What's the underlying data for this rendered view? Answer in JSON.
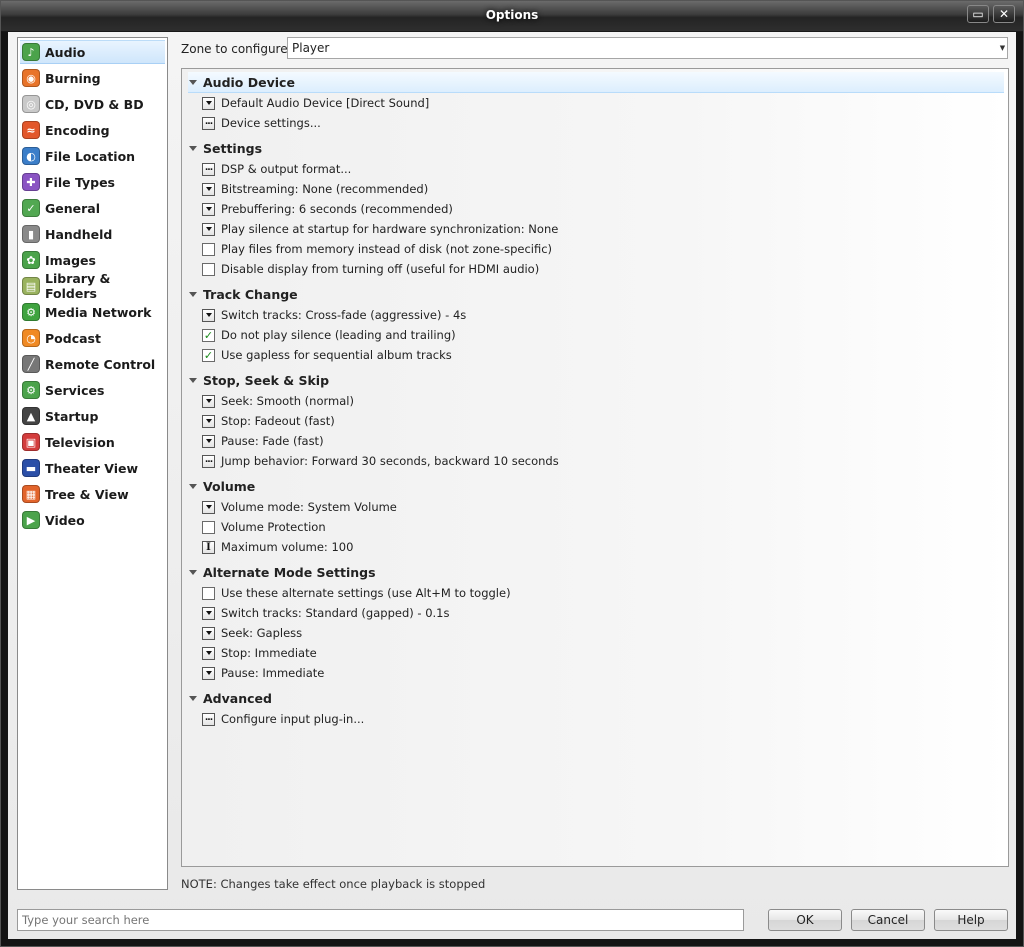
{
  "window": {
    "title": "Options",
    "controls": {
      "restore": "▭",
      "close": "✕"
    }
  },
  "sidebar": {
    "items": [
      {
        "label": "Audio",
        "icon": "audio-icon",
        "color": "#4ba34b",
        "glyph": "♪"
      },
      {
        "label": "Burning",
        "icon": "burning-icon",
        "color": "#e8742a",
        "glyph": "◉"
      },
      {
        "label": "CD, DVD & BD",
        "icon": "disc-icon",
        "color": "#c9c9c9",
        "glyph": "◎"
      },
      {
        "label": "Encoding",
        "icon": "encoding-icon",
        "color": "#e2572b",
        "glyph": "≈"
      },
      {
        "label": "File Location",
        "icon": "globe-icon",
        "color": "#3b7ec9",
        "glyph": "◐"
      },
      {
        "label": "File Types",
        "icon": "file-types-icon",
        "color": "#8a54c3",
        "glyph": "✚"
      },
      {
        "label": "General",
        "icon": "general-icon",
        "color": "#52a852",
        "glyph": "✓"
      },
      {
        "label": "Handheld",
        "icon": "handheld-icon",
        "color": "#8a8a8a",
        "glyph": "▮"
      },
      {
        "label": "Images",
        "icon": "images-icon",
        "color": "#4ba34b",
        "glyph": "✿"
      },
      {
        "label": "Library & Folders",
        "icon": "library-icon",
        "color": "#9ab35f",
        "glyph": "▤"
      },
      {
        "label": "Media Network",
        "icon": "media-network-icon",
        "color": "#3fa33f",
        "glyph": "⚙"
      },
      {
        "label": "Podcast",
        "icon": "podcast-icon",
        "color": "#f08a24",
        "glyph": "◔"
      },
      {
        "label": "Remote Control",
        "icon": "remote-control-icon",
        "color": "#777777",
        "glyph": "╱"
      },
      {
        "label": "Services",
        "icon": "services-icon",
        "color": "#4ba34b",
        "glyph": "⚙"
      },
      {
        "label": "Startup",
        "icon": "startup-icon",
        "color": "#444444",
        "glyph": "▲"
      },
      {
        "label": "Television",
        "icon": "television-icon",
        "color": "#d33c3c",
        "glyph": "▣"
      },
      {
        "label": "Theater View",
        "icon": "theater-view-icon",
        "color": "#2b4fa8",
        "glyph": "▬"
      },
      {
        "label": "Tree & View",
        "icon": "tree-view-icon",
        "color": "#e2642b",
        "glyph": "▦"
      },
      {
        "label": "Video",
        "icon": "video-icon",
        "color": "#4ba34b",
        "glyph": "▶"
      }
    ]
  },
  "zone": {
    "label": "Zone to configure:",
    "value": "Player"
  },
  "groups": [
    {
      "title": "Audio Device",
      "items": [
        {
          "type": "dropdown",
          "label": "Default Audio Device [Direct Sound]"
        },
        {
          "type": "dots",
          "label": "Device settings..."
        }
      ]
    },
    {
      "title": "Settings",
      "items": [
        {
          "type": "dots",
          "label": "DSP & output format..."
        },
        {
          "type": "dropdown",
          "label": "Bitstreaming: None (recommended)"
        },
        {
          "type": "dropdown",
          "label": "Prebuffering: 6 seconds (recommended)"
        },
        {
          "type": "dropdown",
          "label": "Play silence at startup for hardware synchronization: None"
        },
        {
          "type": "checkbox",
          "checked": false,
          "label": "Play files from memory instead of disk (not zone-specific)"
        },
        {
          "type": "checkbox",
          "checked": false,
          "label": "Disable display from turning off (useful for HDMI audio)"
        }
      ]
    },
    {
      "title": "Track Change",
      "items": [
        {
          "type": "dropdown",
          "label": "Switch tracks: Cross-fade (aggressive) - 4s"
        },
        {
          "type": "checkbox",
          "checked": true,
          "label": "Do not play silence (leading and trailing)"
        },
        {
          "type": "checkbox",
          "checked": true,
          "label": "Use gapless for sequential album tracks"
        }
      ]
    },
    {
      "title": "Stop, Seek & Skip",
      "items": [
        {
          "type": "dropdown",
          "label": "Seek: Smooth (normal)"
        },
        {
          "type": "dropdown",
          "label": "Stop: Fadeout (fast)"
        },
        {
          "type": "dropdown",
          "label": "Pause: Fade (fast)"
        },
        {
          "type": "dots",
          "label": "Jump behavior: Forward 30 seconds, backward 10 seconds"
        }
      ]
    },
    {
      "title": "Volume",
      "items": [
        {
          "type": "dropdown",
          "label": "Volume mode: System Volume"
        },
        {
          "type": "checkbox",
          "checked": false,
          "label": "Volume Protection"
        },
        {
          "type": "edit",
          "label": "Maximum volume: 100"
        }
      ]
    },
    {
      "title": "Alternate Mode Settings",
      "items": [
        {
          "type": "checkbox",
          "checked": false,
          "label": "Use these alternate settings (use Alt+M to toggle)"
        },
        {
          "type": "dropdown",
          "label": "Switch tracks: Standard (gapped) - 0.1s"
        },
        {
          "type": "dropdown",
          "label": "Seek: Gapless"
        },
        {
          "type": "dropdown",
          "label": "Stop: Immediate"
        },
        {
          "type": "dropdown",
          "label": "Pause: Immediate"
        }
      ]
    },
    {
      "title": "Advanced",
      "items": [
        {
          "type": "dots",
          "label": "Configure input plug-in..."
        }
      ]
    }
  ],
  "note": "NOTE: Changes take effect once playback is stopped",
  "search": {
    "placeholder": "Type your search here"
  },
  "buttons": {
    "ok": "OK",
    "cancel": "Cancel",
    "help": "Help"
  }
}
